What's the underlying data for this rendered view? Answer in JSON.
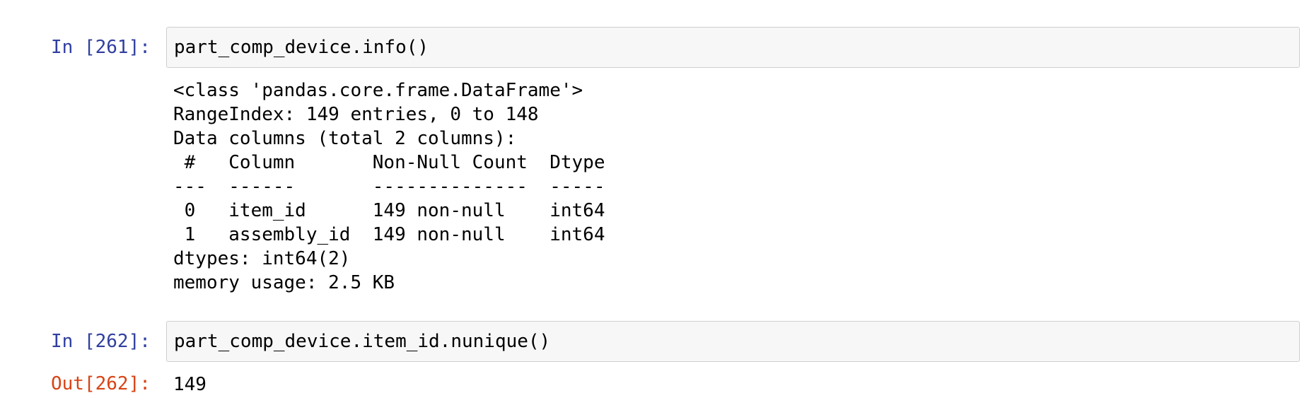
{
  "cells": [
    {
      "prompt": "In [261]:",
      "code": "part_comp_device.info()",
      "stdout_lines": [
        "<class 'pandas.core.frame.DataFrame'>",
        "RangeIndex: 149 entries, 0 to 148",
        "Data columns (total 2 columns):",
        " #   Column       Non-Null Count  Dtype",
        "---  ------       --------------  -----",
        " 0   item_id      149 non-null    int64",
        " 1   assembly_id  149 non-null    int64",
        "dtypes: int64(2)",
        "memory usage: 2.5 KB"
      ]
    },
    {
      "prompt": "In [262]:",
      "code": "part_comp_device.item_id.nunique()",
      "out_prompt": "Out[262]:",
      "result": "149"
    }
  ],
  "colors": {
    "in_prompt": "#303f9f",
    "out_prompt": "#d84315",
    "input_background": "#f7f7f7",
    "input_border": "#cfcfcf"
  }
}
